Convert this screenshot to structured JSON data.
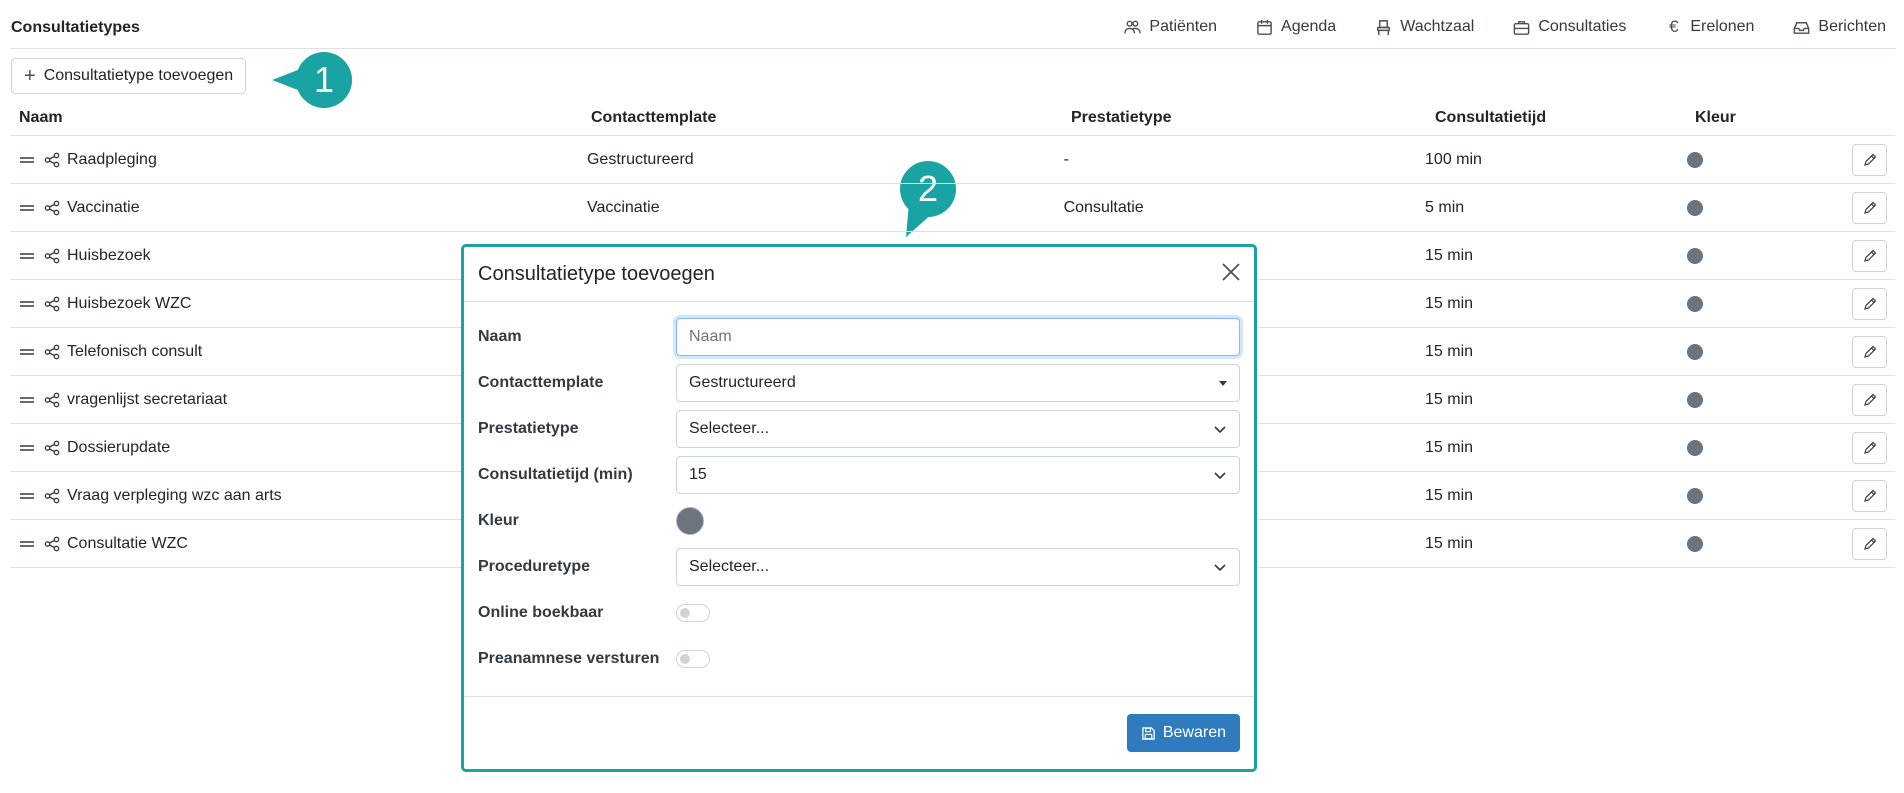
{
  "header": {
    "title": "Consultatietypes",
    "nav": [
      {
        "label": "Patiënten",
        "icon": "users-icon"
      },
      {
        "label": "Agenda",
        "icon": "calendar-icon"
      },
      {
        "label": "Wachtzaal",
        "icon": "chair-icon"
      },
      {
        "label": "Consultaties",
        "icon": "briefcase-icon"
      },
      {
        "label": "Erelonen",
        "icon": "euro-icon"
      },
      {
        "label": "Berichten",
        "icon": "inbox-icon"
      }
    ]
  },
  "toolbar": {
    "add_label": "Consultatietype toevoegen"
  },
  "callouts": {
    "one": "1",
    "two": "2",
    "color": "#1aa3a3"
  },
  "table": {
    "columns": [
      "Naam",
      "Contacttemplate",
      "Prestatietype",
      "Consultatietijd",
      "Kleur"
    ],
    "rows": [
      {
        "naam": "Raadpleging",
        "contacttemplate": "Gestructureerd",
        "prestatietype": "-",
        "tijd": "100 min"
      },
      {
        "naam": "Vaccinatie",
        "contacttemplate": "Vaccinatie",
        "prestatietype": "Consultatie",
        "tijd": "5 min"
      },
      {
        "naam": "Huisbezoek",
        "contacttemplate": "",
        "prestatietype": "",
        "tijd": "15 min"
      },
      {
        "naam": "Huisbezoek WZC",
        "contacttemplate": "",
        "prestatietype": "",
        "tijd": "15 min"
      },
      {
        "naam": "Telefonisch consult",
        "contacttemplate": "",
        "prestatietype": "",
        "tijd": "15 min"
      },
      {
        "naam": "vragenlijst secretariaat",
        "contacttemplate": "",
        "prestatietype": "",
        "tijd": "15 min"
      },
      {
        "naam": "Dossierupdate",
        "contacttemplate": "",
        "prestatietype": "",
        "tijd": "15 min"
      },
      {
        "naam": "Vraag verpleging wzc aan arts",
        "contacttemplate": "",
        "prestatietype": "",
        "tijd": "15 min"
      },
      {
        "naam": "Consultatie WZC",
        "contacttemplate": "",
        "prestatietype": "",
        "tijd": "15 min"
      }
    ],
    "dot_color": "#6c757d"
  },
  "modal": {
    "title": "Consultatietype toevoegen",
    "fields": {
      "naam": {
        "label": "Naam",
        "placeholder": "Naam",
        "value": ""
      },
      "contacttemplate": {
        "label": "Contacttemplate",
        "value": "Gestructureerd"
      },
      "prestatietype": {
        "label": "Prestatietype",
        "value": "Selecteer..."
      },
      "consultatietijd": {
        "label": "Consultatietijd (min)",
        "value": "15"
      },
      "kleur": {
        "label": "Kleur",
        "value": "#6c757d"
      },
      "proceduretype": {
        "label": "Proceduretype",
        "value": "Selecteer..."
      },
      "online_boekbaar": {
        "label": "Online boekbaar",
        "checked": false
      },
      "preanamnese": {
        "label": "Preanamnese versturen",
        "checked": false
      }
    },
    "save_label": "Bewaren",
    "border_color": "#1aa3a3",
    "save_color": "#2f7bbf"
  }
}
